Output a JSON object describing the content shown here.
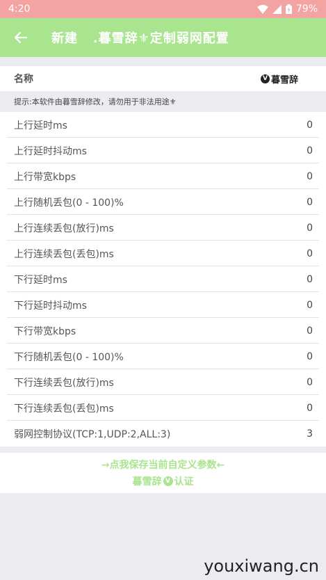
{
  "status": {
    "time": "4:20",
    "battery": "79%"
  },
  "appbar": {
    "title": "新建   .暮雪辞⚜定制弱网配置"
  },
  "name_row": {
    "label": "名称",
    "value": "暮雪辞",
    "badge": "V"
  },
  "hint": "提示:本软件由暮雪辞修改，请勿用于非法用途⚜",
  "rows": [
    {
      "label": "上行延时ms",
      "value": "0"
    },
    {
      "label": "上行延时抖动ms",
      "value": "0"
    },
    {
      "label": "上行带宽kbps",
      "value": "0"
    },
    {
      "label": "上行随机丢包(0 - 100)%",
      "value": "0"
    },
    {
      "label": "上行连续丢包(放行)ms",
      "value": "0"
    },
    {
      "label": "上行连续丢包(丢包)ms",
      "value": "0"
    },
    {
      "label": "下行延时ms",
      "value": "0"
    },
    {
      "label": "下行延时抖动ms",
      "value": "0"
    },
    {
      "label": "下行带宽kbps",
      "value": "0"
    },
    {
      "label": "下行随机丢包(0 - 100)%",
      "value": "0"
    },
    {
      "label": "下行连续丢包(放行)ms",
      "value": "0"
    },
    {
      "label": "下行连续丢包(丢包)ms",
      "value": "0"
    },
    {
      "label": "弱网控制协议(TCP:1,UDP:2,ALL:3)",
      "value": "3"
    }
  ],
  "save": {
    "line1": "→点我保存当前自定义参数←",
    "line2_prefix": "暮雪辞",
    "badge": "V",
    "line2_suffix": "认证"
  },
  "watermark": "youxiwang.cn",
  "colors": {
    "statusbar": "#f4a3a3",
    "appbar": "#a9e48f",
    "accent_text": "#a9e48f"
  }
}
